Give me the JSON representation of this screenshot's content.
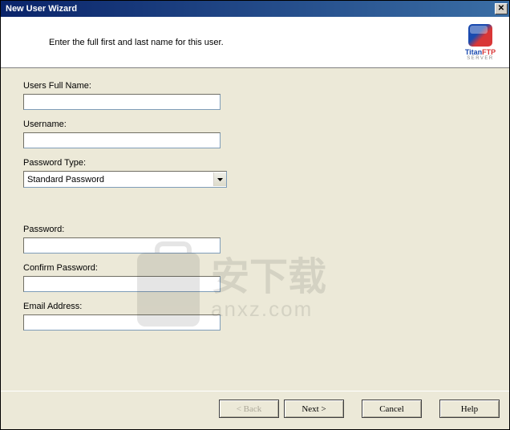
{
  "titlebar": {
    "title": "New User Wizard"
  },
  "header": {
    "instruction": "Enter the full first and last name for this user.",
    "logo": {
      "titan": "Titan",
      "ftp": "FTP",
      "sub": "SERVER"
    }
  },
  "form": {
    "fullname": {
      "label": "Users Full Name:",
      "value": ""
    },
    "username": {
      "label": "Username:",
      "value": ""
    },
    "pwdtype": {
      "label": "Password Type:",
      "value": "Standard Password"
    },
    "password": {
      "label": "Password:",
      "value": ""
    },
    "confirm": {
      "label": "Confirm Password:",
      "value": ""
    },
    "email": {
      "label": "Email Address:",
      "value": ""
    }
  },
  "footer": {
    "back": "< Back",
    "next": "Next >",
    "cancel": "Cancel",
    "help": "Help"
  },
  "watermark": {
    "cn": "安下载",
    "dom": "anxz.com"
  }
}
